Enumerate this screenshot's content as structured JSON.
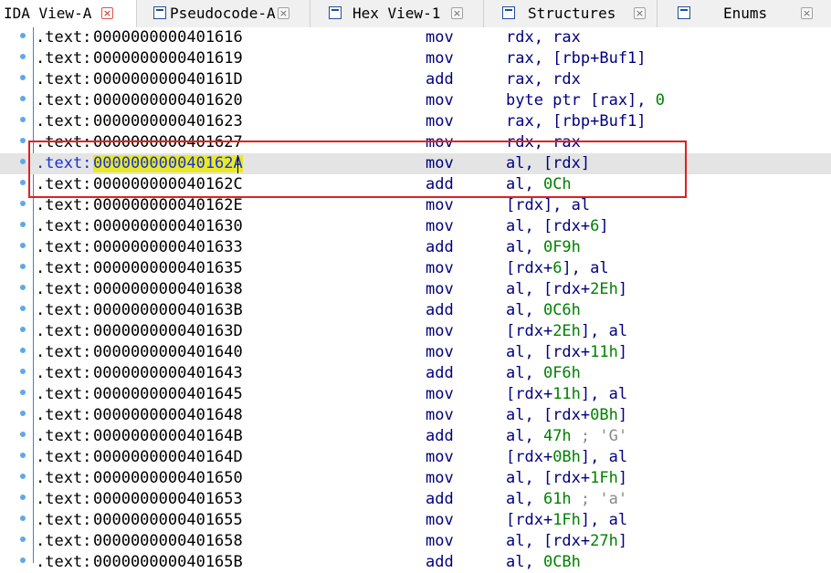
{
  "tabs": [
    {
      "label": "IDA View-A",
      "icon": "none",
      "active": true
    },
    {
      "label": "Pseudocode-A",
      "icon": "pseudocode-icon",
      "active": false
    },
    {
      "label": "Hex View-1",
      "icon": "hex-view-icon",
      "active": false
    },
    {
      "label": "Structures",
      "icon": "structures-icon",
      "active": false
    },
    {
      "label": "Enums",
      "icon": "enums-icon",
      "active": false
    }
  ],
  "close_glyph": "×",
  "listing": {
    "rows": [
      {
        "seg": ".text:",
        "addr": "0000000000401616",
        "mnem": "mov",
        "ops": [
          {
            "t": "rdx, rax",
            "c": "sym"
          }
        ]
      },
      {
        "seg": ".text:",
        "addr": "0000000000401619",
        "mnem": "mov",
        "ops": [
          {
            "t": "rax, [rbp+Buf1]",
            "c": "sym"
          }
        ]
      },
      {
        "seg": ".text:",
        "addr": "000000000040161D",
        "mnem": "add",
        "ops": [
          {
            "t": "rax, rdx",
            "c": "sym"
          }
        ]
      },
      {
        "seg": ".text:",
        "addr": "0000000000401620",
        "mnem": "mov",
        "ops": [
          {
            "t": "byte ptr [rax], ",
            "c": "sym"
          },
          {
            "t": "0",
            "c": "num"
          }
        ]
      },
      {
        "seg": ".text:",
        "addr": "0000000000401623",
        "mnem": "mov",
        "ops": [
          {
            "t": "rax, [rbp+Buf1]",
            "c": "sym"
          }
        ]
      },
      {
        "seg": ".text:",
        "addr": "0000000000401627",
        "mnem": "mov",
        "ops": [
          {
            "t": "rdx, rax",
            "c": "sym"
          }
        ]
      },
      {
        "seg": ".text:",
        "addr": "000000000040162A",
        "mnem": "mov",
        "ops": [
          {
            "t": "al, [rdx]",
            "c": "sym"
          }
        ],
        "highlight": true
      },
      {
        "seg": ".text:",
        "addr": "000000000040162C",
        "mnem": "add",
        "ops": [
          {
            "t": "al, ",
            "c": "sym"
          },
          {
            "t": "0Ch",
            "c": "num"
          }
        ]
      },
      {
        "seg": ".text:",
        "addr": "000000000040162E",
        "mnem": "mov",
        "ops": [
          {
            "t": "[rdx], al",
            "c": "sym"
          }
        ]
      },
      {
        "seg": ".text:",
        "addr": "0000000000401630",
        "mnem": "mov",
        "ops": [
          {
            "t": "al, [rdx+",
            "c": "sym"
          },
          {
            "t": "6",
            "c": "num"
          },
          {
            "t": "]",
            "c": "sym"
          }
        ]
      },
      {
        "seg": ".text:",
        "addr": "0000000000401633",
        "mnem": "add",
        "ops": [
          {
            "t": "al, ",
            "c": "sym"
          },
          {
            "t": "0F9h",
            "c": "num"
          }
        ]
      },
      {
        "seg": ".text:",
        "addr": "0000000000401635",
        "mnem": "mov",
        "ops": [
          {
            "t": "[rdx+",
            "c": "sym"
          },
          {
            "t": "6",
            "c": "num"
          },
          {
            "t": "], al",
            "c": "sym"
          }
        ]
      },
      {
        "seg": ".text:",
        "addr": "0000000000401638",
        "mnem": "mov",
        "ops": [
          {
            "t": "al, [rdx+",
            "c": "sym"
          },
          {
            "t": "2Eh",
            "c": "num"
          },
          {
            "t": "]",
            "c": "sym"
          }
        ]
      },
      {
        "seg": ".text:",
        "addr": "000000000040163B",
        "mnem": "add",
        "ops": [
          {
            "t": "al, ",
            "c": "sym"
          },
          {
            "t": "0C6h",
            "c": "num"
          }
        ]
      },
      {
        "seg": ".text:",
        "addr": "000000000040163D",
        "mnem": "mov",
        "ops": [
          {
            "t": "[rdx+",
            "c": "sym"
          },
          {
            "t": "2Eh",
            "c": "num"
          },
          {
            "t": "], al",
            "c": "sym"
          }
        ]
      },
      {
        "seg": ".text:",
        "addr": "0000000000401640",
        "mnem": "mov",
        "ops": [
          {
            "t": "al, [rdx+",
            "c": "sym"
          },
          {
            "t": "11h",
            "c": "num"
          },
          {
            "t": "]",
            "c": "sym"
          }
        ]
      },
      {
        "seg": ".text:",
        "addr": "0000000000401643",
        "mnem": "add",
        "ops": [
          {
            "t": "al, ",
            "c": "sym"
          },
          {
            "t": "0F6h",
            "c": "num"
          }
        ]
      },
      {
        "seg": ".text:",
        "addr": "0000000000401645",
        "mnem": "mov",
        "ops": [
          {
            "t": "[rdx+",
            "c": "sym"
          },
          {
            "t": "11h",
            "c": "num"
          },
          {
            "t": "], al",
            "c": "sym"
          }
        ]
      },
      {
        "seg": ".text:",
        "addr": "0000000000401648",
        "mnem": "mov",
        "ops": [
          {
            "t": "al, [rdx+",
            "c": "sym"
          },
          {
            "t": "0Bh",
            "c": "num"
          },
          {
            "t": "]",
            "c": "sym"
          }
        ]
      },
      {
        "seg": ".text:",
        "addr": "000000000040164B",
        "mnem": "add",
        "ops": [
          {
            "t": "al, ",
            "c": "sym"
          },
          {
            "t": "47h",
            "c": "num"
          },
          {
            "t": " ; 'G'",
            "c": "cmt"
          }
        ]
      },
      {
        "seg": ".text:",
        "addr": "000000000040164D",
        "mnem": "mov",
        "ops": [
          {
            "t": "[rdx+",
            "c": "sym"
          },
          {
            "t": "0Bh",
            "c": "num"
          },
          {
            "t": "], al",
            "c": "sym"
          }
        ]
      },
      {
        "seg": ".text:",
        "addr": "0000000000401650",
        "mnem": "mov",
        "ops": [
          {
            "t": "al, [rdx+",
            "c": "sym"
          },
          {
            "t": "1Fh",
            "c": "num"
          },
          {
            "t": "]",
            "c": "sym"
          }
        ]
      },
      {
        "seg": ".text:",
        "addr": "0000000000401653",
        "mnem": "add",
        "ops": [
          {
            "t": "al, ",
            "c": "sym"
          },
          {
            "t": "61h",
            "c": "num"
          },
          {
            "t": " ; 'a'",
            "c": "cmt"
          }
        ]
      },
      {
        "seg": ".text:",
        "addr": "0000000000401655",
        "mnem": "mov",
        "ops": [
          {
            "t": "[rdx+",
            "c": "sym"
          },
          {
            "t": "1Fh",
            "c": "num"
          },
          {
            "t": "], al",
            "c": "sym"
          }
        ]
      },
      {
        "seg": ".text:",
        "addr": "0000000000401658",
        "mnem": "mov",
        "ops": [
          {
            "t": "al, [rdx+",
            "c": "sym"
          },
          {
            "t": "27h",
            "c": "num"
          },
          {
            "t": "]",
            "c": "sym"
          }
        ]
      },
      {
        "seg": ".text:",
        "addr": "000000000040165B",
        "mnem": "add",
        "ops": [
          {
            "t": "al, ",
            "c": "sym"
          },
          {
            "t": "0CBh",
            "c": "num"
          }
        ]
      }
    ]
  },
  "colors": {
    "highlight_row": "#e4e4e4",
    "address_highlight": "#e9e927",
    "annotation_box": "#e02020",
    "gutter_dot": "#5fa8e8"
  }
}
